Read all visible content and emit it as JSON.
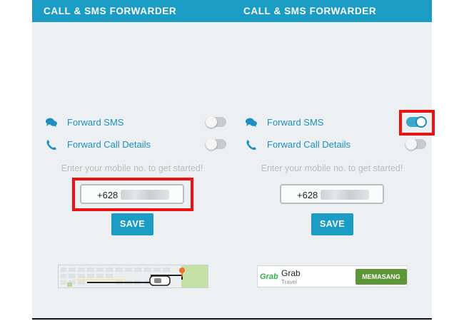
{
  "app": {
    "title": "CALL & SMS FORWARDER"
  },
  "panels": [
    {
      "forward_sms_label": "Forward SMS",
      "forward_sms_enabled": false,
      "forward_call_label": "Forward Call Details",
      "forward_call_enabled": false,
      "hint": "Enter your mobile no. to get started!",
      "phone_value": "+628",
      "save_label": "SAVE",
      "highlighted": "phone-input"
    },
    {
      "forward_sms_label": "Forward SMS",
      "forward_sms_enabled": true,
      "forward_call_label": "Forward Call Details",
      "forward_call_enabled": false,
      "hint": "Enter your mobile no. to get started!",
      "phone_value": "+628",
      "save_label": "SAVE",
      "highlighted": "forward-sms-toggle"
    }
  ],
  "ads": {
    "grab": {
      "logo": "Grab",
      "title": "Grab",
      "subtitle": "Travel",
      "button": "MEMASANG"
    }
  },
  "colors": {
    "header": "#1a9cc4",
    "accent_text": "#1f8fbe",
    "highlight": "#ee1111",
    "install_button": "#5c9636"
  }
}
